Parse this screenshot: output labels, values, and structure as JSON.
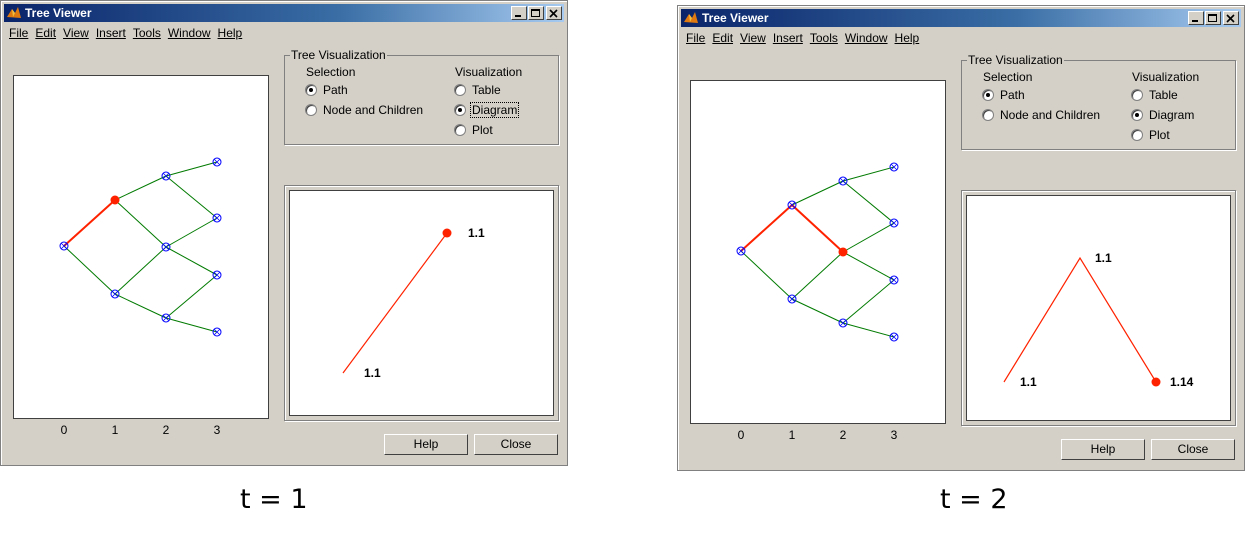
{
  "colors": {
    "path_red": "#ff2200",
    "tree_green": "#007a00",
    "node_blue": "#0000ff"
  },
  "windows": [
    {
      "title": "Tree Viewer",
      "menu": [
        "File",
        "Edit",
        "View",
        "Insert",
        "Tools",
        "Window",
        "Help"
      ],
      "group_title": "Tree Visualization",
      "selection_label": "Selection",
      "selection_options": [
        {
          "label": "Path",
          "selected": true
        },
        {
          "label": "Node and Children",
          "selected": false
        }
      ],
      "visualization_label": "Visualization",
      "visualization_options": [
        {
          "label": "Table",
          "selected": false
        },
        {
          "label": "Diagram",
          "selected": true
        },
        {
          "label": "Plot",
          "selected": false
        }
      ],
      "x_ticks": [
        "0",
        "1",
        "2",
        "3"
      ],
      "highlighted_path": [
        "0,0",
        "1,1"
      ],
      "diagram_labels": [
        "1.1",
        "1.1"
      ],
      "help_button": "Help",
      "close_button": "Close",
      "caption": "t = 1"
    },
    {
      "title": "Tree Viewer",
      "menu": [
        "File",
        "Edit",
        "View",
        "Insert",
        "Tools",
        "Window",
        "Help"
      ],
      "group_title": "Tree Visualization",
      "selection_label": "Selection",
      "selection_options": [
        {
          "label": "Path",
          "selected": true
        },
        {
          "label": "Node and Children",
          "selected": false
        }
      ],
      "visualization_label": "Visualization",
      "visualization_options": [
        {
          "label": "Table",
          "selected": false
        },
        {
          "label": "Diagram",
          "selected": true
        },
        {
          "label": "Plot",
          "selected": false
        }
      ],
      "x_ticks": [
        "0",
        "1",
        "2",
        "3"
      ],
      "highlighted_path": [
        "0,0",
        "1,1",
        "2,1"
      ],
      "diagram_labels": [
        "1.1",
        "1.1",
        "1.14"
      ],
      "help_button": "Help",
      "close_button": "Close",
      "caption": "t = 2"
    }
  ]
}
